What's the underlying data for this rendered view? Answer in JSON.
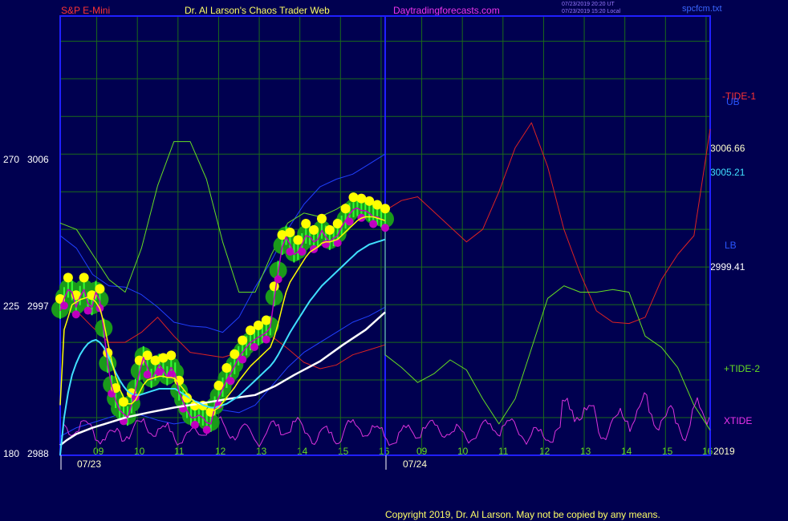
{
  "header": {
    "instrument": "S&P E-Mini",
    "title": "Dr. Al Larson's Chaos Trader Web",
    "site": "Daytradingforecasts.com",
    "time_ut": "07/23/2019 20:20 UT",
    "time_local": "07/23/2019 15:20 Local",
    "file": "spcfcm.txt"
  },
  "footer": {
    "copyright": "Copyright 2019, Dr. Al Larson. May not be copied by any means."
  },
  "colors": {
    "background": "#000050",
    "frame": "#2020ff",
    "grid": "#1a6a1a",
    "price": "#c000c0",
    "ema_fast": "#ffff00",
    "ema_mid": "#40e0ff",
    "ema_slow": "#ffffff",
    "tide1": "#dd2222",
    "tide2": "#66dd22",
    "xtide": "#dd33dd",
    "band": "#2040ff"
  },
  "chart_data": {
    "type": "line",
    "title": "S&P E-Mini",
    "left_axis": {
      "ticks": [
        {
          "angle": "180",
          "price": "2988"
        },
        {
          "angle": "225",
          "price": "2997"
        },
        {
          "angle": "270",
          "price": "3006"
        }
      ],
      "ylim": [
        2988,
        3023
      ]
    },
    "x_axis": {
      "hour_ticks": [
        "09",
        "10",
        "11",
        "12",
        "13",
        "14",
        "15",
        "16",
        "09",
        "10",
        "11",
        "12",
        "13",
        "14",
        "15",
        "16"
      ],
      "dates": [
        "07/23",
        "07/24"
      ],
      "year_label": "2019"
    },
    "right_labels": {
      "tide1": "-TIDE-1",
      "ub": "UB",
      "price_ema": "3006.66",
      "price_ema_mid": "3005.21",
      "lb": "LB",
      "price_ema_slow": "2999.41",
      "tide2": "+TIDE-2",
      "xtide": "XTIDE"
    },
    "series": [
      {
        "key": "price",
        "color": "#c000c0",
        "values": [
          2999.5,
          3000.5,
          3001.2,
          3001.0,
          2999.8,
          3000.6,
          3001.2,
          3000.1,
          2999.8,
          3001.0,
          3000.3,
          2998.0,
          2995.2,
          2993.5,
          2992.4,
          2991.6,
          2991.3,
          2991.0,
          2992.0,
          2993.2,
          2994.6,
          2995.8,
          2995.0,
          2994.0,
          2994.6,
          2995.2,
          2994.8,
          2994.2,
          2995.0,
          2994.5,
          2993.0,
          2992.3,
          2991.6,
          2991.0,
          2991.0,
          2991.2,
          2991.0,
          2990.6,
          2990.5,
          2991.8,
          2992.6,
          2993.3,
          2994.0,
          2994.5,
          2995.1,
          2995.8,
          2996.2,
          2996.6,
          2997.0,
          2997.2,
          2997.4,
          2997.6,
          2997.8,
          2998.2,
          3000.5,
          3002.6,
          3004.6,
          3005.4,
          3004.8,
          3004.0,
          3004.2,
          3004.8,
          3005.5,
          3005.4,
          3005.0,
          3005.2,
          3005.9,
          3005.4,
          3005.0,
          3005.3,
          3005.5,
          3006.2,
          3006.7,
          3007.2,
          3007.6,
          3007.7,
          3007.5,
          3007.5,
          3007.3,
          3007.0,
          3007.0,
          3006.8,
          3006.7
        ]
      },
      {
        "key": "ema_fast",
        "color": "#ffff00",
        "values": [
          2992,
          2998,
          2999,
          3000,
          3000.2,
          3000.4,
          3000.5,
          3000.6,
          3000.5,
          3000.2,
          2999.7,
          2998.6,
          2997.0,
          2995.5,
          2994.3,
          2993.3,
          2992.6,
          2992.1,
          2992.1,
          2992.4,
          2993.0,
          2993.6,
          2994.0,
          2994.1,
          2994.2,
          2994.3,
          2994.3,
          2994.2,
          2994.2,
          2994.1,
          2993.7,
          2993.3,
          2992.9,
          2992.5,
          2992.2,
          2992.0,
          2991.8,
          2991.6,
          2991.5,
          2991.6,
          2991.8,
          2992.2,
          2992.6,
          2993.0,
          2993.4,
          2993.9,
          2994.3,
          2994.7,
          2995.1,
          2995.4,
          2995.7,
          2996.0,
          2996.3,
          2996.6,
          2997.4,
          2998.5,
          2999.8,
          3001.0,
          3001.8,
          3002.3,
          3002.8,
          3003.3,
          3003.8,
          3004.2,
          3004.4,
          3004.6,
          3004.9,
          3005.0,
          3005.0,
          3005.1,
          3005.2,
          3005.5,
          3005.8,
          3006.1,
          3006.4,
          3006.7,
          3006.9,
          3007.0,
          3007.0,
          3007.0,
          3006.9,
          3006.8,
          3006.7
        ]
      },
      {
        "key": "ema_mid",
        "color": "#40e0ff",
        "values": [
          2988,
          2991,
          2993,
          2994.4,
          2995.3,
          2996.0,
          2996.5,
          2996.9,
          2997.1,
          2997.2,
          2997.0,
          2996.6,
          2996.0,
          2995.3,
          2994.6,
          2994.0,
          2993.5,
          2993.1,
          2992.9,
          2992.8,
          2992.8,
          2992.9,
          2993.0,
          2993.1,
          2993.2,
          2993.3,
          2993.3,
          2993.3,
          2993.3,
          2993.3,
          2993.1,
          2992.9,
          2992.7,
          2992.5,
          2992.3,
          2992.2,
          2992.0,
          2991.9,
          2991.8,
          2991.8,
          2991.9,
          2992.0,
          2992.1,
          2992.3,
          2992.5,
          2992.7,
          2993.0,
          2993.3,
          2993.6,
          2993.9,
          2994.2,
          2994.5,
          2994.8,
          2995.1,
          2995.5,
          2996.0,
          2996.6,
          2997.2,
          2997.8,
          2998.3,
          2998.8,
          2999.3,
          2999.8,
          3000.3,
          3000.7,
          3001.1,
          3001.5,
          3001.8,
          3002.1,
          3002.4,
          3002.7,
          3003.0,
          3003.3,
          3003.6,
          3003.9,
          3004.2,
          3004.4,
          3004.6,
          3004.8,
          3004.9,
          3005.0,
          3005.1,
          3005.2
        ]
      },
      {
        "key": "ema_slow",
        "color": "#ffffff",
        "x_days": [
          0.0,
          0.02,
          0.05,
          0.1,
          0.15,
          0.2,
          0.27,
          0.35,
          0.45,
          0.52,
          0.6,
          0.66,
          0.72,
          0.8,
          0.87,
          0.94,
          1.0
        ],
        "values": [
          2988.8,
          2989.2,
          2989.7,
          2990.2,
          2990.6,
          2991.0,
          2991.4,
          2991.8,
          2992.2,
          2992.5,
          2992.8,
          2993.5,
          2994.4,
          2995.5,
          2996.8,
          2998.0,
          2999.4
        ]
      },
      {
        "key": "upper_band",
        "color": "#2040ff",
        "x_days": [
          0.0,
          0.05,
          0.1,
          0.15,
          0.2,
          0.25,
          0.3,
          0.35,
          0.4,
          0.45,
          0.5,
          0.55,
          0.6,
          0.65,
          0.7,
          0.75,
          0.8,
          0.85,
          0.9,
          0.95,
          1.0,
          1.0
        ],
        "values": [
          3005.5,
          3004.5,
          3002.4,
          3001.5,
          3001.4,
          3000.8,
          2999.8,
          2998.6,
          2998.3,
          2998.2,
          2997.8,
          2999.0,
          3001.4,
          3003.5,
          3006.0,
          3008.0,
          3009.4,
          3010.0,
          3010.4,
          3011.2,
          3012.0,
          3012.0
        ]
      },
      {
        "key": "lower_band",
        "color": "#2040ff",
        "x_days": [
          0.0,
          0.05,
          0.1,
          0.15,
          0.2,
          0.25,
          0.3,
          0.35,
          0.4,
          0.45,
          0.5,
          0.55,
          0.6,
          0.65,
          0.7,
          0.75,
          0.8,
          0.85,
          0.9,
          0.95,
          1.0
        ],
        "values": [
          2989.5,
          2990.2,
          2990.6,
          2991.0,
          2991.4,
          2991.2,
          2990.8,
          2990.5,
          2990.7,
          2991.3,
          2991.6,
          2991.4,
          2992.0,
          2993.5,
          2995.0,
          2996.2,
          2997.0,
          2997.8,
          2998.6,
          2999.1,
          2999.8
        ]
      },
      {
        "key": "tide1",
        "label": "-TIDE-1",
        "color": "#dd2222",
        "x_days": [
          0.0,
          0.05,
          0.1,
          0.15,
          0.2,
          0.25,
          0.3,
          0.35,
          0.4,
          0.45,
          0.5,
          0.55,
          0.6,
          0.65,
          0.7,
          0.75,
          0.8,
          0.85,
          0.9,
          0.95,
          1.0,
          1.0,
          1.05,
          1.1,
          1.15,
          1.2,
          1.25,
          1.3,
          1.35,
          1.4,
          1.45,
          1.5,
          1.55,
          1.6,
          1.65,
          1.7,
          1.75,
          1.8,
          1.85,
          1.9,
          1.95,
          2.0
        ],
        "values": [
          2999.8,
          2999.5,
          2998.2,
          2997.0,
          2997.0,
          2997.8,
          2999.0,
          2997.5,
          2996.2,
          2996.0,
          2995.8,
          2996.2,
          2997.2,
          2997.5,
          2996.5,
          2995.4,
          2994.9,
          2995.2,
          2996.0,
          2996.4,
          2996.8,
          3007.5,
          3008.3,
          3008.6,
          3007.4,
          3006.2,
          3005.0,
          3006.0,
          3009.0,
          3012.5,
          3014.5,
          3011.0,
          3006.0,
          3002.5,
          2999.5,
          2998.6,
          2998.5,
          2999.0,
          3002.0,
          3004.0,
          3005.5,
          3014.0
        ]
      },
      {
        "key": "tide2",
        "label": "+TIDE-2",
        "color": "#66dd22",
        "x_days": [
          0.0,
          0.05,
          0.1,
          0.15,
          0.2,
          0.25,
          0.3,
          0.35,
          0.4,
          0.45,
          0.5,
          0.55,
          0.6,
          0.65,
          0.7,
          0.75,
          0.8,
          0.85,
          0.9,
          0.95,
          1.0,
          1.0,
          1.05,
          1.1,
          1.15,
          1.2,
          1.25,
          1.3,
          1.35,
          1.4,
          1.45,
          1.5,
          1.55,
          1.6,
          1.65,
          1.7,
          1.75,
          1.8,
          1.85,
          1.9,
          1.95,
          2.0
        ],
        "values": [
          3006.5,
          3006.0,
          3004.0,
          3002.0,
          3001.0,
          3004.5,
          3009.5,
          3013.0,
          3013.0,
          3010.0,
          3005.0,
          3001.0,
          3001.0,
          3004.0,
          3006.5,
          3007.3,
          3007.0,
          3007.6,
          3008.4,
          3008.0,
          3007.6,
          2996.0,
          2995.0,
          2993.8,
          2994.5,
          2995.6,
          2994.8,
          2992.5,
          2990.5,
          2992.5,
          2996.5,
          3000.5,
          3001.5,
          3001.0,
          3001.0,
          3001.2,
          3001.0,
          2997.5,
          2996.6,
          2995.0,
          2992.0,
          2990.0
        ]
      },
      {
        "key": "xtide",
        "label": "XTIDE",
        "color": "#dd33dd",
        "seed": 7
      }
    ]
  }
}
